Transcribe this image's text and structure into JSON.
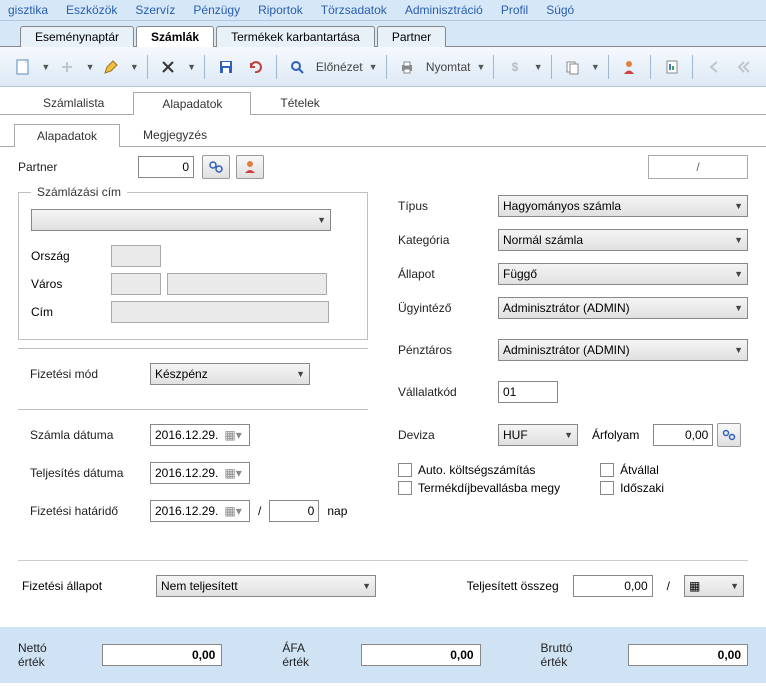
{
  "menu": {
    "items": [
      "gisztika",
      "Eszközök",
      "Szervíz",
      "Pénzügy",
      "Riportok",
      "Törzsadatok",
      "Adminisztráció",
      "Profil",
      "Súgó"
    ]
  },
  "fileTabs": [
    "Eseménynaptár",
    "Számlák",
    "Termékek karbantartása",
    "Partner"
  ],
  "activeFileTab": 1,
  "toolbar": {
    "preview": "Előnézet",
    "print": "Nyomtat"
  },
  "sectionTabs": [
    "Számlalista",
    "Alapadatok",
    "Tételek"
  ],
  "subTabs": [
    "Alapadatok",
    "Megjegyzés"
  ],
  "partner": {
    "label": "Partner",
    "value": "0"
  },
  "billing": {
    "legend": "Számlázási cím",
    "country": "Ország",
    "city": "Város",
    "address": "Cím"
  },
  "payment": {
    "label": "Fizetési mód",
    "value": "Készpénz"
  },
  "dates": {
    "invoice": {
      "label": "Számla dátuma",
      "value": "2016.12.29."
    },
    "fulfill": {
      "label": "Teljesítés dátuma",
      "value": "2016.12.29."
    },
    "due": {
      "label": "Fizetési határidő",
      "value": "2016.12.29.",
      "days": "0",
      "unit": "nap"
    }
  },
  "right": {
    "type": {
      "label": "Típus",
      "value": "Hagyományos számla"
    },
    "category": {
      "label": "Kategória",
      "value": "Normál számla"
    },
    "state": {
      "label": "Állapot",
      "value": "Függő"
    },
    "clerk": {
      "label": "Ügyintéző",
      "value": "Adminisztrátor (ADMIN)"
    },
    "cashier": {
      "label": "Pénztáros",
      "value": "Adminisztrátor (ADMIN)"
    },
    "company": {
      "label": "Vállalatkód",
      "value": "01"
    },
    "currency": {
      "label": "Deviza",
      "value": "HUF",
      "rateLabel": "Árfolyam",
      "rate": "0,00"
    },
    "chk1": "Auto. költségszámítás",
    "chk2": "Termékdíjbevallásba megy",
    "chk3": "Átvállal",
    "chk4": "Időszaki"
  },
  "payState": {
    "label": "Fizetési állapot",
    "value": "Nem teljesített",
    "paidLabel": "Teljesített összeg",
    "paid": "0,00"
  },
  "totals": {
    "net": {
      "label": "Nettó érték",
      "value": "0,00"
    },
    "vat": {
      "label": "ÁFA érték",
      "value": "0,00"
    },
    "gross": {
      "label": "Bruttó érték",
      "value": "0,00"
    }
  }
}
